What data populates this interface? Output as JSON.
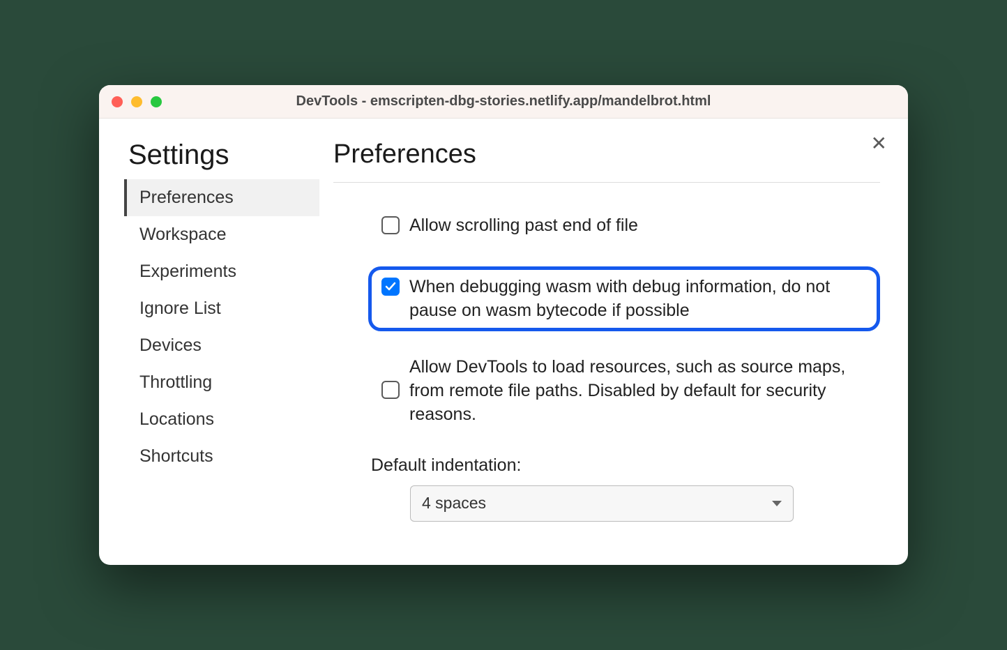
{
  "window": {
    "title": "DevTools - emscripten-dbg-stories.netlify.app/mandelbrot.html"
  },
  "sidebar": {
    "heading": "Settings",
    "items": [
      {
        "label": "Preferences",
        "active": true
      },
      {
        "label": "Workspace",
        "active": false
      },
      {
        "label": "Experiments",
        "active": false
      },
      {
        "label": "Ignore List",
        "active": false
      },
      {
        "label": "Devices",
        "active": false
      },
      {
        "label": "Throttling",
        "active": false
      },
      {
        "label": "Locations",
        "active": false
      },
      {
        "label": "Shortcuts",
        "active": false
      }
    ]
  },
  "main": {
    "heading": "Preferences",
    "options": [
      {
        "label": "Allow scrolling past end of file",
        "checked": false,
        "highlighted": false
      },
      {
        "label": "When debugging wasm with debug information, do not pause on wasm bytecode if possible",
        "checked": true,
        "highlighted": true
      },
      {
        "label": "Allow DevTools to load resources, such as source maps, from remote file paths. Disabled by default for security reasons.",
        "checked": false,
        "highlighted": false
      }
    ],
    "indentation": {
      "label": "Default indentation:",
      "value": "4 spaces"
    }
  }
}
